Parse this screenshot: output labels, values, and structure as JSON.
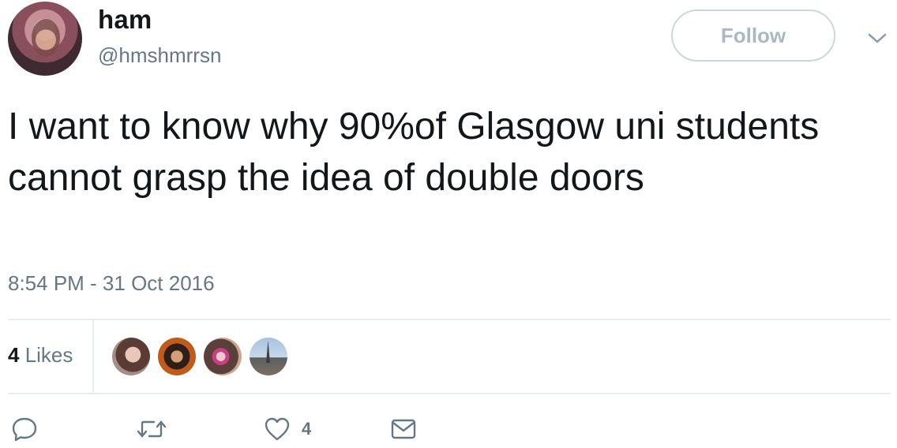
{
  "author": {
    "display_name": "ham",
    "handle": "@hmshmrrsn",
    "avatar_icon": "profile-photo"
  },
  "header": {
    "follow_label": "Follow",
    "menu_icon": "chevron-down-icon"
  },
  "tweet": {
    "text": "I want to know why 90%of Glasgow uni students cannot grasp the idea of double doors",
    "timestamp": "8:54 PM - 31 Oct 2016"
  },
  "stats": {
    "likes_number": "4",
    "likes_label": " Likes",
    "liker_avatars": [
      "liker-avatar",
      "liker-avatar",
      "liker-avatar",
      "liker-avatar"
    ]
  },
  "actions": {
    "reply_icon": "reply-icon",
    "retweet_icon": "retweet-icon",
    "like_icon": "heart-icon",
    "like_count": "4",
    "message_icon": "envelope-icon"
  },
  "colors": {
    "text_primary": "#14171a",
    "text_secondary": "#657786",
    "border": "#e6ecf0",
    "follow_border": "#ccd6dd",
    "follow_text": "#aab8c2"
  }
}
